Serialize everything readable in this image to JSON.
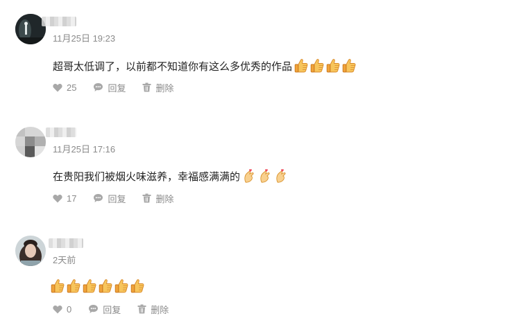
{
  "comments": [
    {
      "timestamp": "11月25日 19:23",
      "text": "超哥太低调了，以前都不知道你有这么多优秀的作品",
      "emojis": [
        "thumbs-up",
        "thumbs-up",
        "thumbs-up",
        "thumbs-up"
      ],
      "likes": "25",
      "reply_label": "回复",
      "delete_label": "删除"
    },
    {
      "timestamp": "11月25日 17:16",
      "text": "在贵阳我们被烟火味滋养，幸福感满满的",
      "emojis": [
        "finger-heart",
        "finger-heart",
        "finger-heart"
      ],
      "likes": "17",
      "reply_label": "回复",
      "delete_label": "删除"
    },
    {
      "timestamp": "2天前",
      "text": "",
      "emojis": [
        "thumbs-up",
        "thumbs-up",
        "thumbs-up",
        "thumbs-up",
        "thumbs-up",
        "thumbs-up"
      ],
      "likes": "0",
      "reply_label": "回复",
      "delete_label": "删除"
    }
  ],
  "icons": {
    "like": "heart-icon",
    "reply": "speech-bubble-icon",
    "delete": "trash-icon"
  },
  "colors": {
    "meta_text": "#8a8a8a",
    "body_text": "#222222",
    "icon": "#a8a8a8"
  }
}
